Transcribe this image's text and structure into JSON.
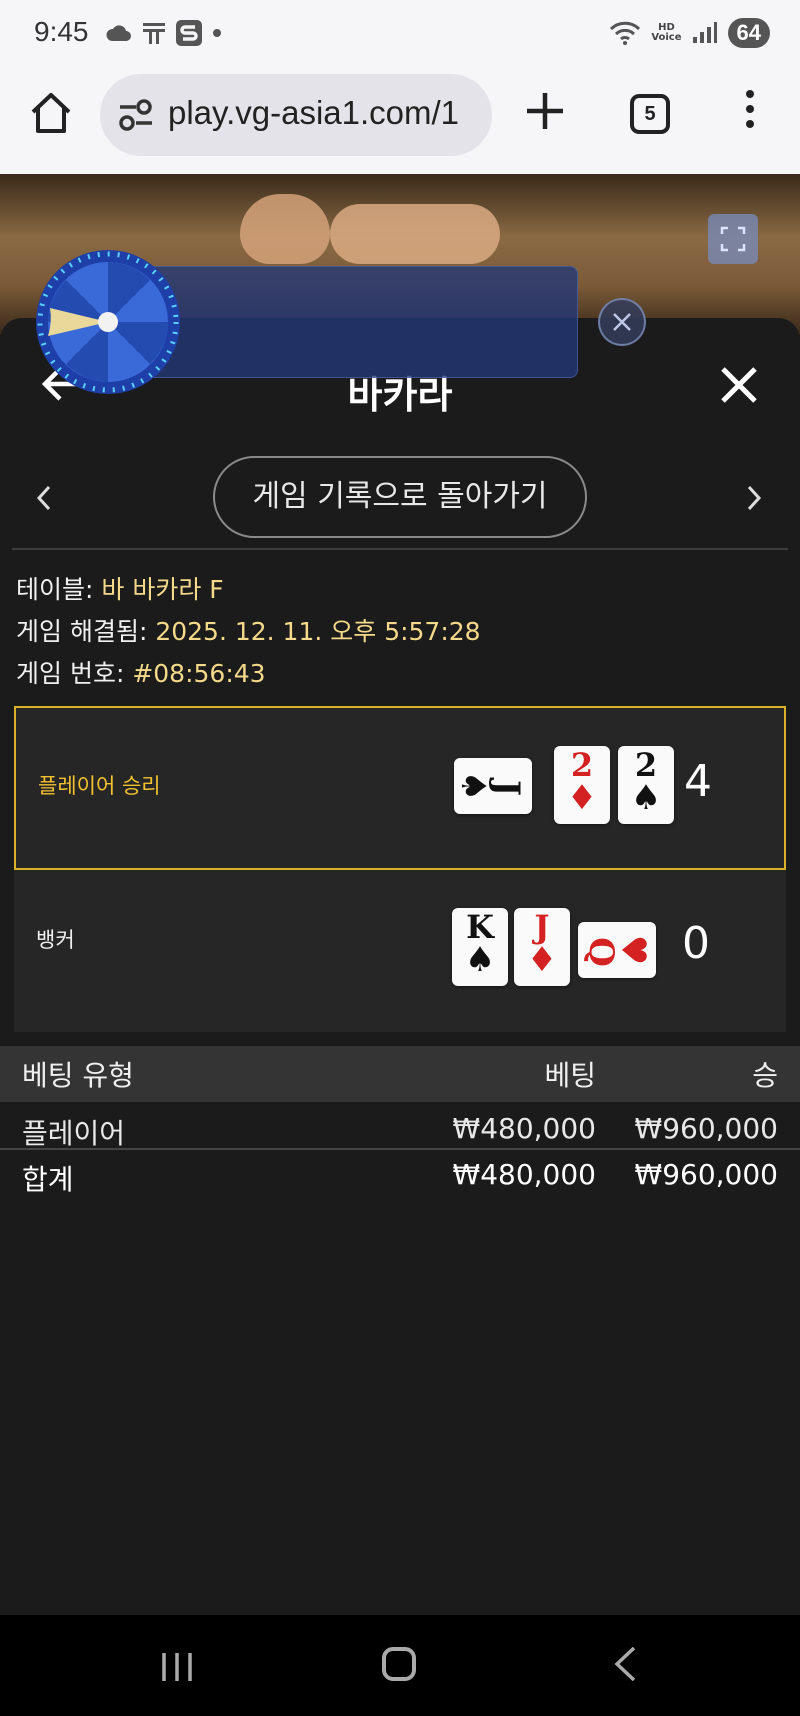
{
  "status_bar": {
    "time": "9:45",
    "battery": "64",
    "hd_top": "HD",
    "hd_bottom": "Voice"
  },
  "browser": {
    "url": "play.vg-asia1.com/1",
    "tab_count": "5"
  },
  "panel": {
    "title": "바카라",
    "back_to_history": "게임 기록으로 돌아가기"
  },
  "game_info": {
    "table_label": "테이블: ",
    "table_value": "바 바카라 F",
    "resolved_label": "게임 해결됨: ",
    "resolved_value": "2025. 12. 11. 오후 5:57:28",
    "number_label": "게임 번호: ",
    "number_value": "#08:56:43"
  },
  "results": {
    "player": {
      "label": "플레이어 승리",
      "score": "4",
      "cards": [
        {
          "rank": "J",
          "suit": "♠",
          "color": "black",
          "orientation": "horizontal"
        },
        {
          "rank": "2",
          "suit": "♦",
          "color": "red",
          "orientation": "vertical"
        },
        {
          "rank": "2",
          "suit": "♠",
          "color": "black",
          "orientation": "vertical"
        }
      ]
    },
    "banker": {
      "label": "뱅커",
      "score": "0",
      "cards": [
        {
          "rank": "K",
          "suit": "♠",
          "color": "black",
          "orientation": "vertical"
        },
        {
          "rank": "J",
          "suit": "♦",
          "color": "red",
          "orientation": "vertical"
        },
        {
          "rank": "Q",
          "suit": "♥",
          "color": "red",
          "orientation": "horizontal"
        }
      ]
    }
  },
  "bets": {
    "headers": {
      "type": "베팅 유형",
      "bet": "베팅",
      "win": "승"
    },
    "rows": [
      {
        "type": "플레이어",
        "bet": "₩480,000",
        "win": "₩960,000"
      }
    ],
    "total": {
      "type": "합계",
      "bet": "₩480,000",
      "win": "₩960,000"
    }
  },
  "colors": {
    "win_border": "#d8b02a",
    "win_label": "#f2c12e",
    "info_value": "#f5d98a",
    "panel_bg": "#1b1b1b"
  }
}
